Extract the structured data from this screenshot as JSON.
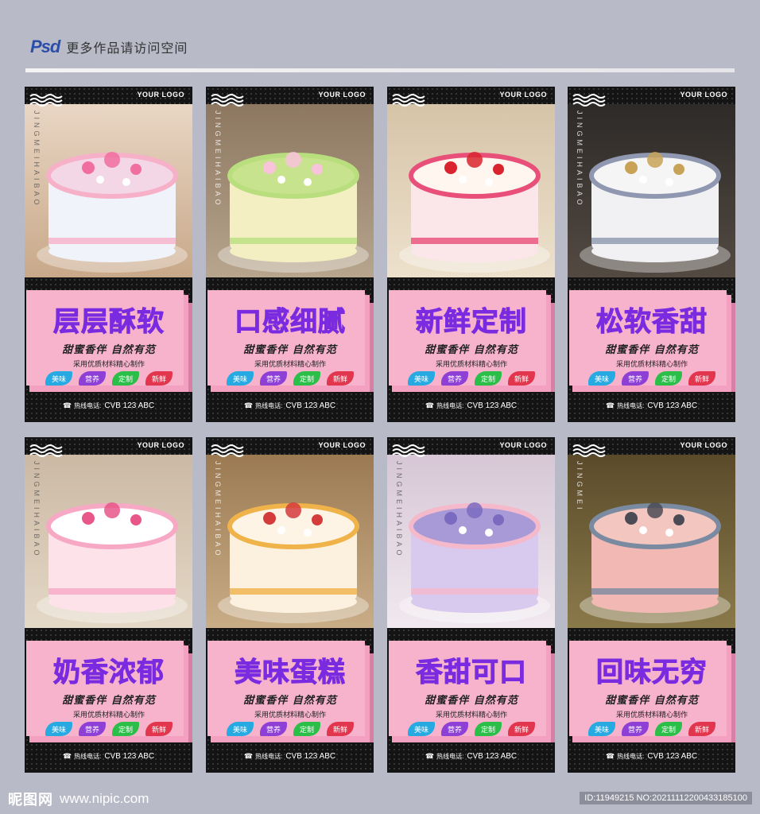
{
  "header": {
    "logo": "Psd",
    "text": "更多作品请访问空间"
  },
  "cards": [
    {
      "title": "层层酥软",
      "logo": "YOUR LOGO",
      "vtext": "JINGMEIHAIBAO",
      "subtitle": "甜蜜香伴 自然有范",
      "desc": "采用优质材料精心制作",
      "hotline_label": "热线电话:",
      "hotline": "CVB 123 ABC",
      "tags": [
        "美味",
        "营养",
        "定制",
        "新鲜"
      ]
    },
    {
      "title": "口感细腻",
      "logo": "YOUR LOGO",
      "vtext": "JINGMEIHAIBAO",
      "subtitle": "甜蜜香伴 自然有范",
      "desc": "采用优质材料精心制作",
      "hotline_label": "热线电话:",
      "hotline": "CVB 123 ABC",
      "tags": [
        "美味",
        "营养",
        "定制",
        "新鲜"
      ]
    },
    {
      "title": "新鲜定制",
      "logo": "YOUR LOGO",
      "vtext": "",
      "subtitle": "甜蜜香伴 自然有范",
      "desc": "采用优质材料精心制作",
      "hotline_label": "热线电话:",
      "hotline": "CVB 123 ABC",
      "tags": [
        "美味",
        "营养",
        "定制",
        "新鲜"
      ]
    },
    {
      "title": "松软香甜",
      "logo": "YOUR LOGO",
      "vtext": "JINGMEIHAIBAO",
      "subtitle": "甜蜜香伴 自然有范",
      "desc": "采用优质材料精心制作",
      "hotline_label": "热线电话:",
      "hotline": "CVB 123 ABC",
      "tags": [
        "美味",
        "营养",
        "定制",
        "新鲜"
      ]
    },
    {
      "title": "奶香浓郁",
      "logo": "YOUR LOGO",
      "vtext": "JINGMEIHAIBAO",
      "subtitle": "甜蜜香伴 自然有范",
      "desc": "采用优质材料精心制作",
      "hotline_label": "热线电话:",
      "hotline": "CVB 123 ABC",
      "tags": [
        "美味",
        "营养",
        "定制",
        "新鲜"
      ]
    },
    {
      "title": "美味蛋糕",
      "logo": "YOUR LOGO",
      "vtext": "JINGMEIHAIBAO",
      "subtitle": "甜蜜香伴 自然有范",
      "desc": "采用优质材料精心制作",
      "hotline_label": "热线电话:",
      "hotline": "CVB 123 ABC",
      "tags": [
        "美味",
        "营养",
        "定制",
        "新鲜"
      ]
    },
    {
      "title": "香甜可口",
      "logo": "YOUR LOGO",
      "vtext": "JINGMEIHAIBAO",
      "subtitle": "甜蜜香伴 自然有范",
      "desc": "采用优质材料精心制作",
      "hotline_label": "热线电话:",
      "hotline": "CVB 123 ABC",
      "tags": [
        "美味",
        "营养",
        "定制",
        "新鲜"
      ]
    },
    {
      "title": "回味无穷",
      "logo": "YOUR LOGO",
      "vtext": "JINGMEI",
      "subtitle": "甜蜜香伴 自然有范",
      "desc": "采用优质材料精心制作",
      "hotline_label": "热线电话:",
      "hotline": "CVB 123 ABC",
      "tags": [
        "美味",
        "营养",
        "定制",
        "新鲜"
      ]
    }
  ],
  "tag_colors": [
    "#27a9e1",
    "#8e3fd6",
    "#2bbf4a",
    "#e2364f"
  ],
  "footer": {
    "logo": "昵图网",
    "url": "www.nipic.com",
    "id": "ID:11949215 NO:20211112200433185100"
  }
}
